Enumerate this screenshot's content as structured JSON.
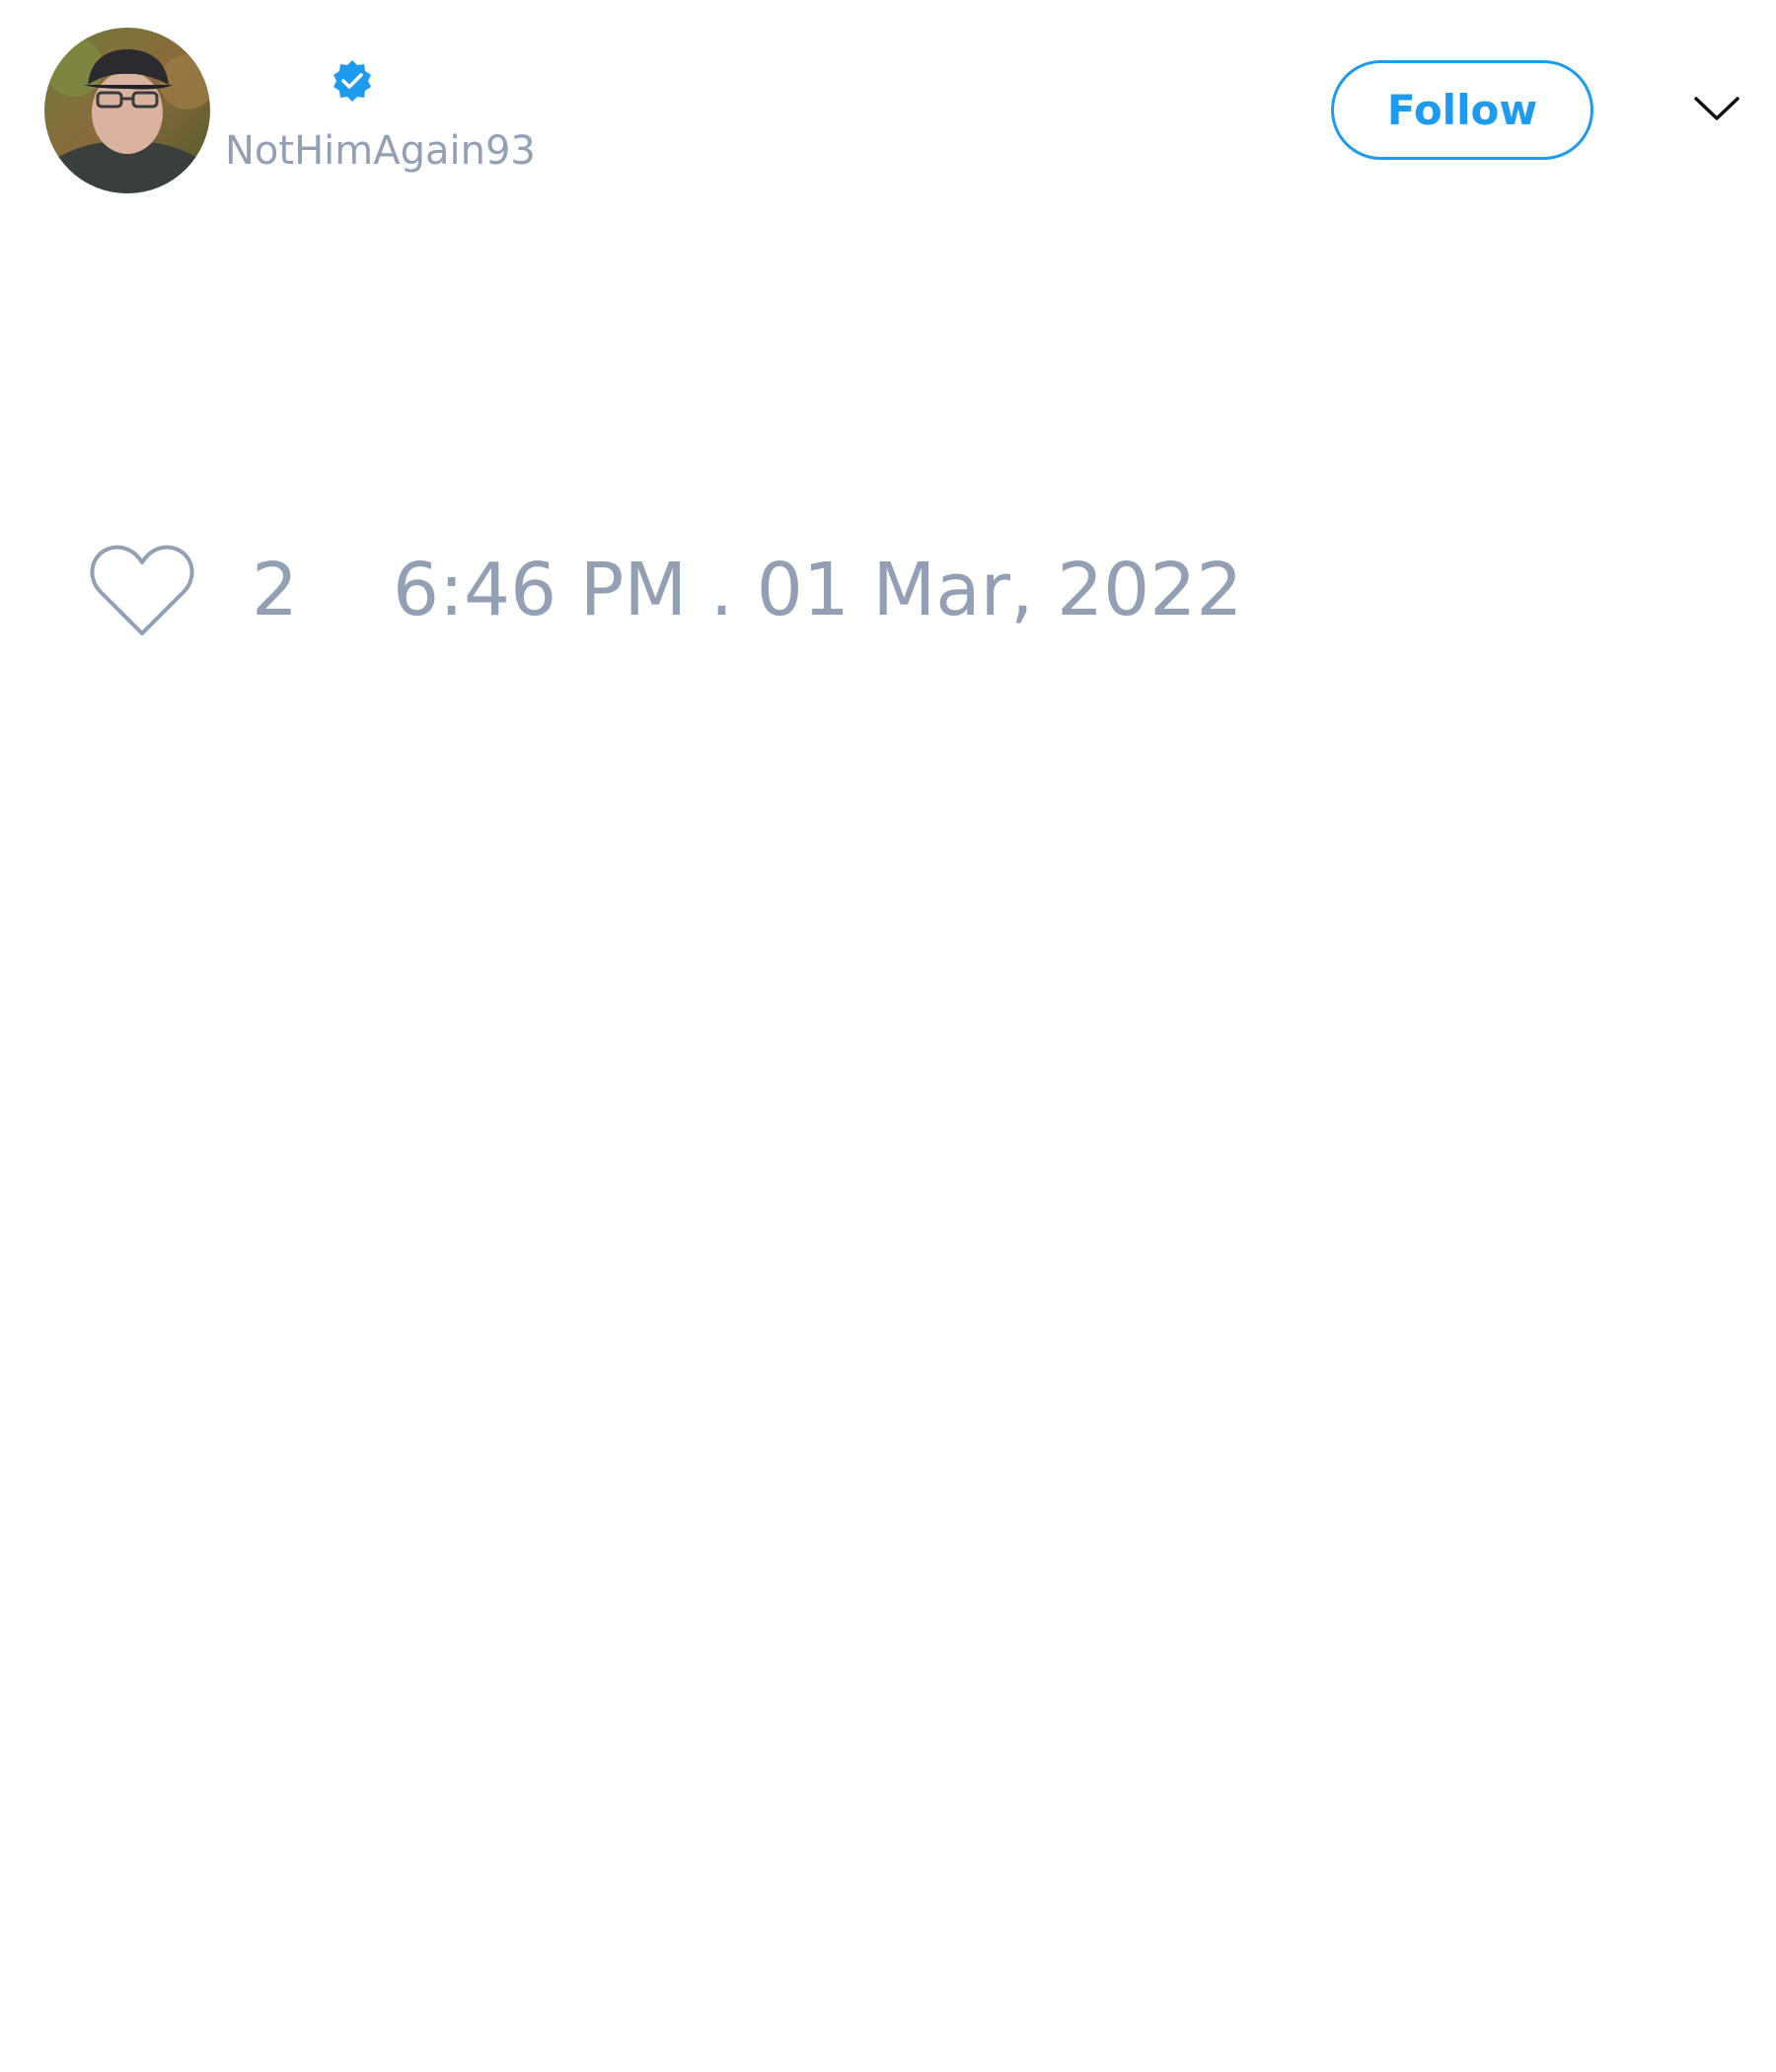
{
  "colors": {
    "accent": "#1d9bf0",
    "muted_text": "#93a0b3",
    "background": "#ffffff"
  },
  "author": {
    "avatar_icon": "user-avatar",
    "verified_icon": "verified-badge-icon",
    "handle": "NotHimAgain93"
  },
  "header": {
    "follow_label": "Follow",
    "more_icon": "chevron-down-icon"
  },
  "footer": {
    "like_icon": "heart-icon",
    "like_count": "2",
    "timestamp": "6:46 PM . 01 Mar, 2022"
  }
}
